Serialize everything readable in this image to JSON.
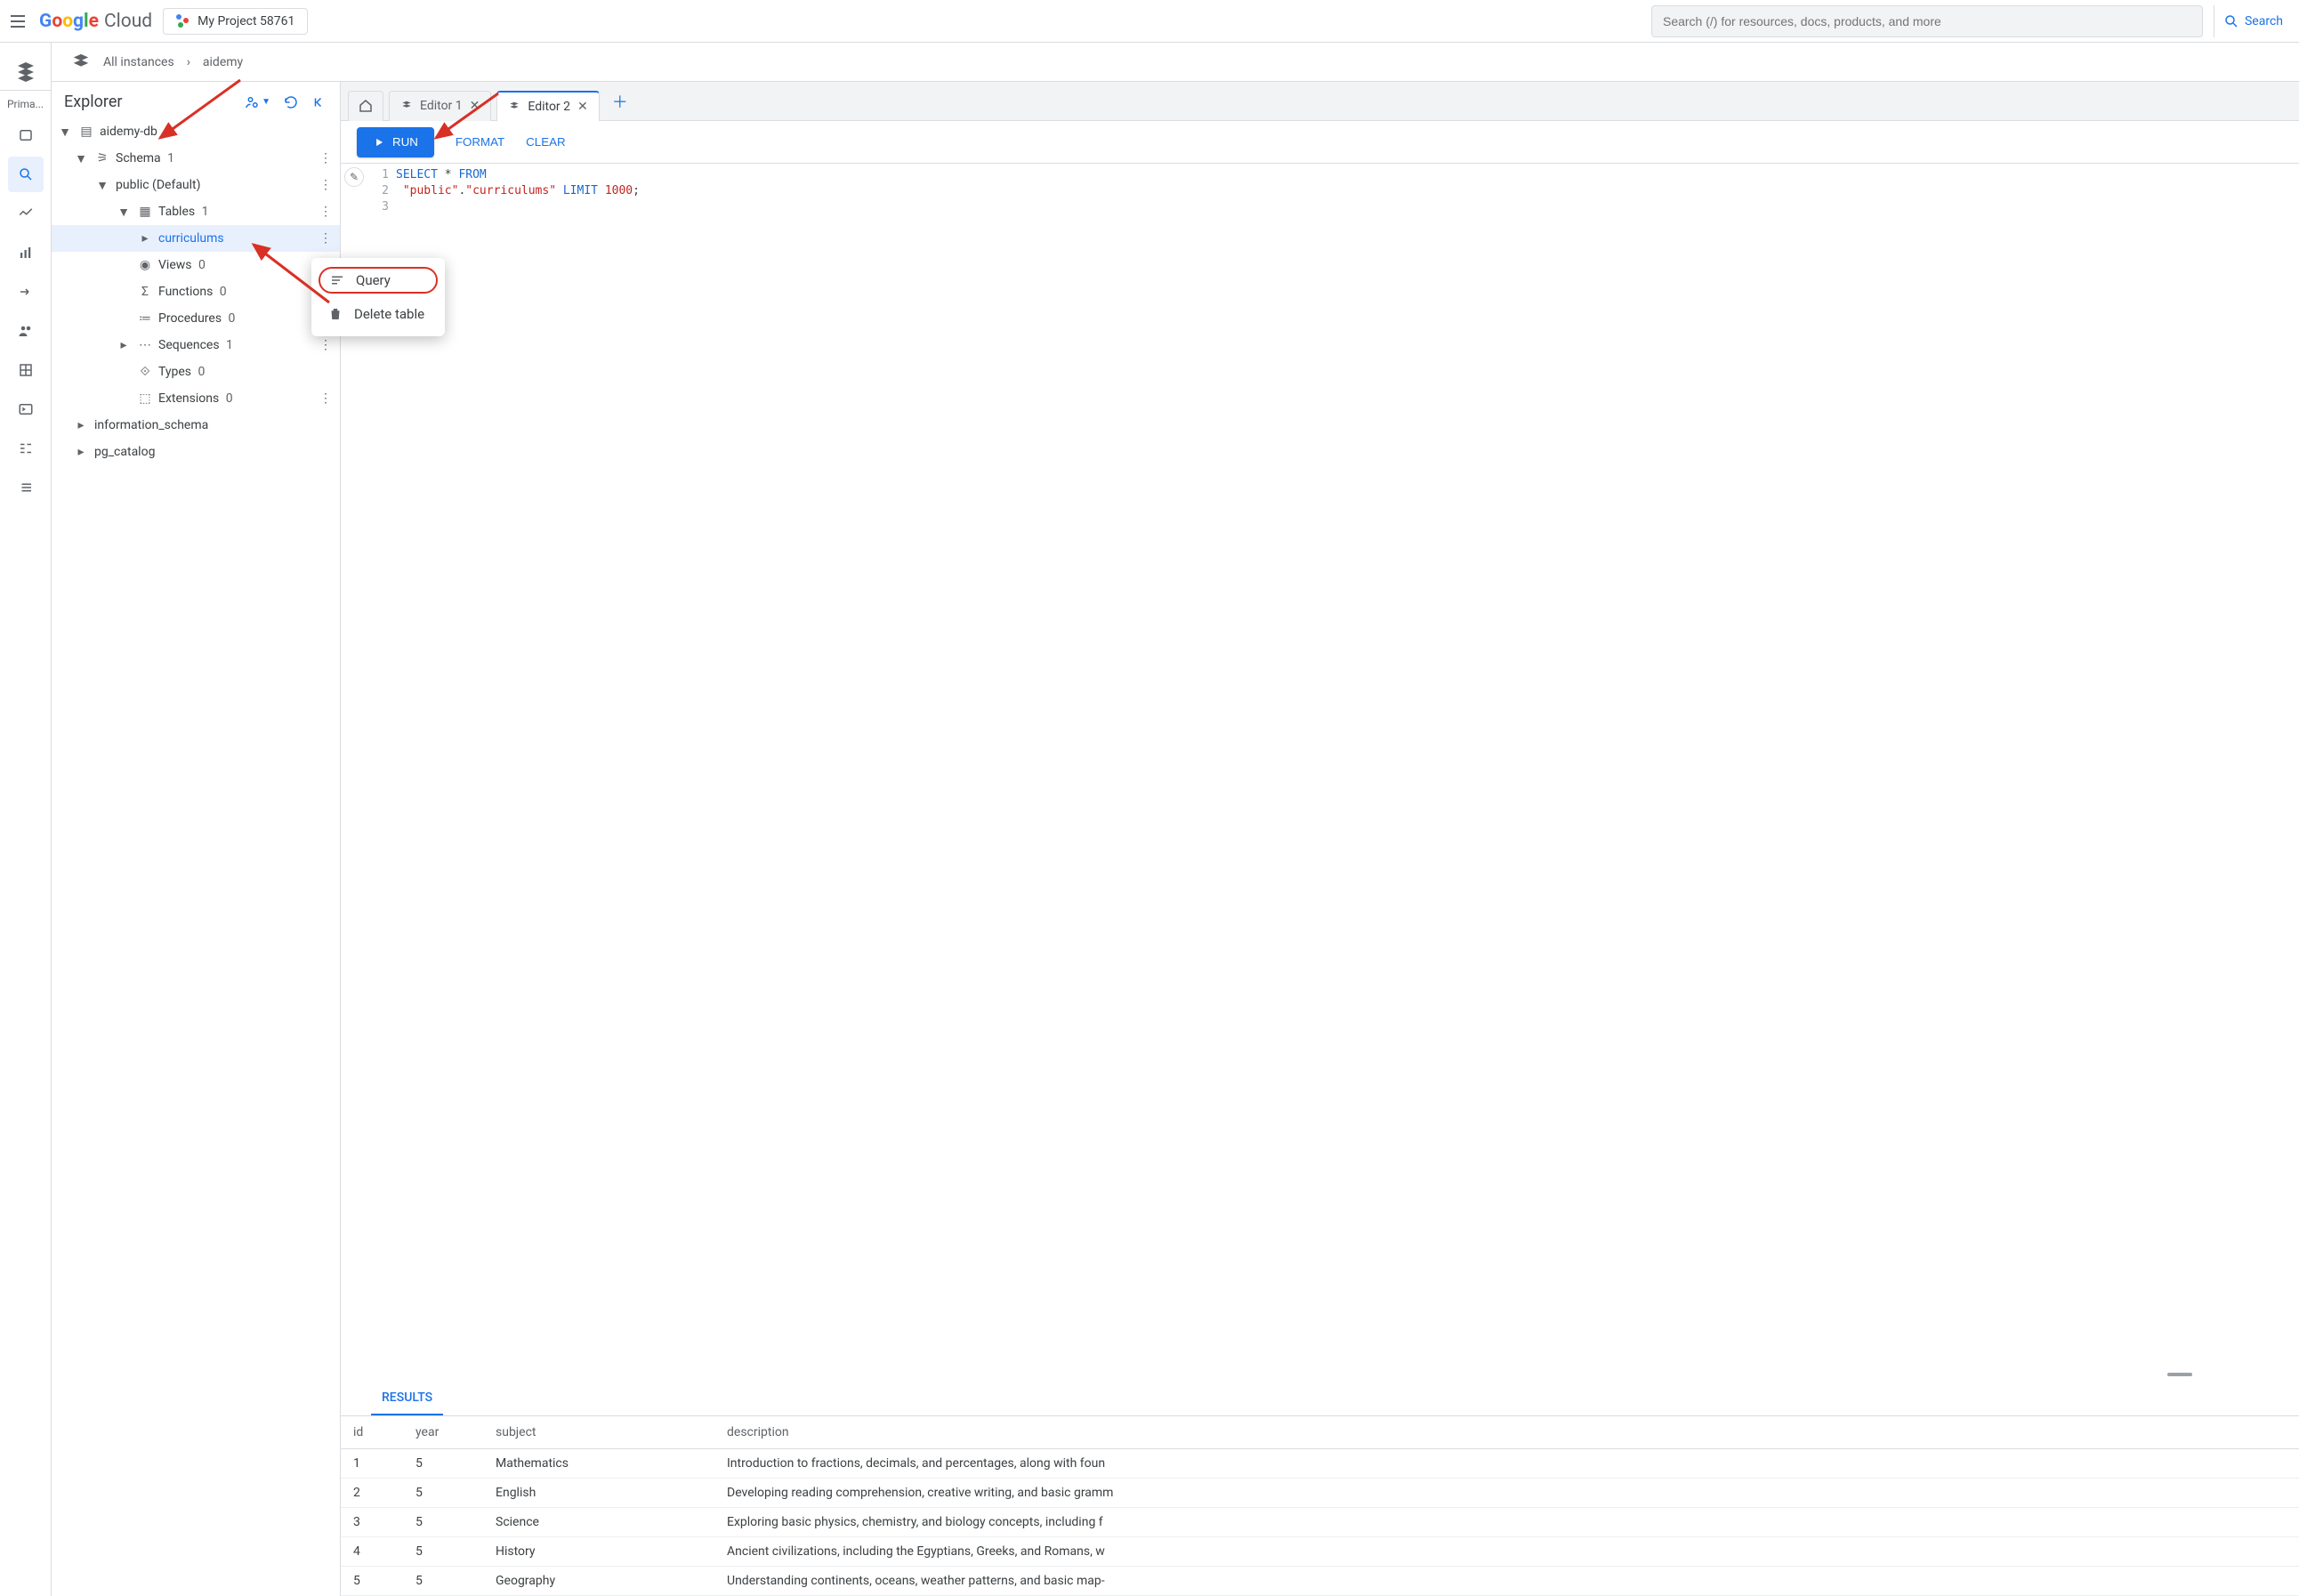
{
  "header": {
    "logo_text": "Google",
    "logo_suffix": "Cloud",
    "project_label": "My Project 58761",
    "search_placeholder": "Search (/) for resources, docs, products, and more",
    "search_button": "Search"
  },
  "rail": {
    "top_label": "Prima..."
  },
  "breadcrumb": {
    "root": "All instances",
    "current": "aidemy"
  },
  "explorer": {
    "title": "Explorer",
    "db": "aidemy-db",
    "schema_label": "Schema",
    "schema_count": "1",
    "public_label": "public (Default)",
    "tables_label": "Tables",
    "tables_count": "1",
    "table_name": "curriculums",
    "views_label": "Views",
    "views_count": "0",
    "functions_label": "Functions",
    "functions_count": "0",
    "procedures_label": "Procedures",
    "procedures_count": "0",
    "sequences_label": "Sequences",
    "sequences_count": "1",
    "types_label": "Types",
    "types_count": "0",
    "extensions_label": "Extensions",
    "extensions_count": "0",
    "info_schema": "information_schema",
    "pg_catalog": "pg_catalog"
  },
  "context_menu": {
    "query": "Query",
    "delete": "Delete table"
  },
  "tabs": {
    "editor1": "Editor 1",
    "editor2": "Editor 2"
  },
  "toolbar": {
    "run": "RUN",
    "format": "FORMAT",
    "clear": "CLEAR"
  },
  "code": {
    "l1_a": "SELECT",
    "l1_b": " * ",
    "l1_c": "FROM",
    "l2_a": " \"public\"",
    "l2_b": ".",
    "l2_c": "\"curriculums\"",
    "l2_d": " LIMIT ",
    "l2_e": "1000",
    "l2_f": ";",
    "n1": "1",
    "n2": "2",
    "n3": "3"
  },
  "results": {
    "tab": "RESULTS",
    "columns": {
      "c1": "id",
      "c2": "year",
      "c3": "subject",
      "c4": "description"
    },
    "rows": [
      {
        "id": "1",
        "year": "5",
        "subject": "Mathematics",
        "description": "Introduction to fractions, decimals, and percentages, along with foun"
      },
      {
        "id": "2",
        "year": "5",
        "subject": "English",
        "description": "Developing reading comprehension, creative writing, and basic gramm"
      },
      {
        "id": "3",
        "year": "5",
        "subject": "Science",
        "description": "Exploring basic physics, chemistry, and biology concepts, including f"
      },
      {
        "id": "4",
        "year": "5",
        "subject": "History",
        "description": "Ancient civilizations, including the Egyptians, Greeks, and Romans, w"
      },
      {
        "id": "5",
        "year": "5",
        "subject": "Geography",
        "description": "Understanding continents, oceans, weather patterns, and basic map-"
      }
    ]
  }
}
